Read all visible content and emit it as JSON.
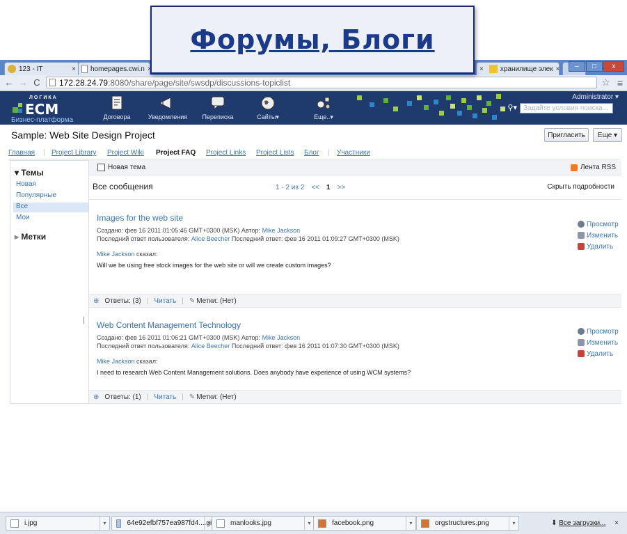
{
  "banner": {
    "title": "Форумы, Блоги"
  },
  "browser": {
    "tabs": [
      {
        "label": "123 - IT"
      },
      {
        "label": "homepages.cwi.n"
      },
      {
        "label": "хранилище элек"
      }
    ],
    "url_host": "172.28.24.79",
    "url_path": ":8080/share/page/site/swsdp/discussions-topiclist"
  },
  "app": {
    "logo_top": "ЛОГИКА",
    "logo_main": "ECM",
    "logo_sub": "Бизнес-платформа",
    "nav": [
      {
        "label": "Договора"
      },
      {
        "label": "Уведомления"
      },
      {
        "label": "Переписка"
      },
      {
        "label": "Сайты▾"
      },
      {
        "label": "Еще..▾"
      }
    ],
    "user": "Administrator ▾",
    "search_placeholder": "Задайте условия поиска..."
  },
  "site": {
    "title": "Sample: Web Site Design Project",
    "invite_label": "Пригласить",
    "more_label": "Еще ▾",
    "nav": [
      {
        "label": "Главная"
      },
      {
        "label": "Project Library"
      },
      {
        "label": "Project Wiki"
      },
      {
        "label": "Project FAQ"
      },
      {
        "label": "Project Links"
      },
      {
        "label": "Project Lists"
      },
      {
        "label": "Блог"
      },
      {
        "label": "Участники"
      }
    ]
  },
  "sidebar": {
    "topics_heading": "Темы",
    "items": [
      {
        "label": "Новая"
      },
      {
        "label": "Популярные"
      },
      {
        "label": "Все"
      },
      {
        "label": "Мои"
      }
    ],
    "tags_heading": "Метки"
  },
  "toolbar": {
    "new_topic": "Новая тема",
    "rss": "Лента RSS"
  },
  "list": {
    "heading": "Все сообщения",
    "range": "1 - 2 из 2",
    "prev": "<<",
    "page": "1",
    "next": ">>",
    "hide_details": "Скрыть подробности"
  },
  "actions": {
    "view": "Просмотр",
    "edit": "Изменить",
    "delete": "Удалить"
  },
  "posts": [
    {
      "title": "Images for the web site",
      "created_prefix": "Создано: фев 16 2011 01:05:46 GMT+0300 (MSK) Автор:",
      "author": "Mike Jackson",
      "last_prefix": "Последний ответ пользователя:",
      "last_user": "Alice Beecher",
      "last_suffix": "Последний ответ: фев 16 2011 01:09:27 GMT+0300 (MSK)",
      "said_user": "Mike Jackson",
      "said_word": "сказал:",
      "body": "Will we be using free stock images for the web site or will we create custom images?",
      "replies": "Ответы: (3)",
      "read": "Читать",
      "tags": "Метки: (Нет)"
    },
    {
      "title": "Web Content Management Technology",
      "created_prefix": "Создано: фев 16 2011 01:06:21 GMT+0300 (MSK) Автор:",
      "author": "Mike Jackson",
      "last_prefix": "Последний ответ пользователя:",
      "last_user": "Alice Beecher",
      "last_suffix": "Последний ответ: фев 16 2011 01:07:30 GMT+0300 (MSK)",
      "said_user": "Mike Jackson",
      "said_word": "сказал:",
      "body": "I need to research Web Content Management solutions. Does anybody have experience of using WCM systems?",
      "replies": "Ответы: (1)",
      "read": "Читать",
      "tags": "Метки: (Нет)"
    }
  ],
  "downloads": {
    "items": [
      {
        "name": "i.jpg"
      },
      {
        "name": "64e92efbf757ea987fd4....gif"
      },
      {
        "name": "manlooks.jpg"
      },
      {
        "name": "facebook.png"
      },
      {
        "name": "orgstructures.png"
      }
    ],
    "all_label": "Все загрузки..."
  }
}
